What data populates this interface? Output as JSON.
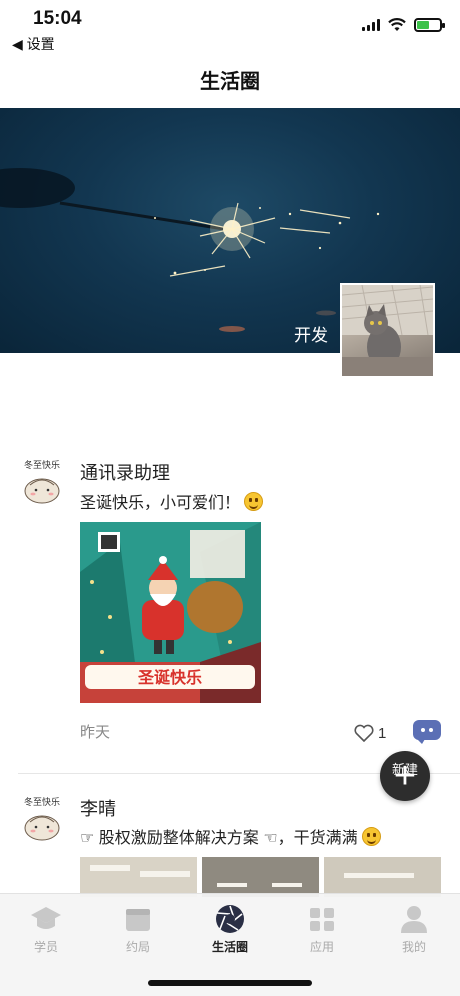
{
  "status_bar": {
    "time": "15:04",
    "back_label": "◀ 设置",
    "battery_color": "#3cc24a"
  },
  "nav": {
    "title": "生活圈"
  },
  "cover": {
    "username": "开发",
    "colors": {
      "sky_top": "#1e4a66",
      "sky_bottom": "#0a2539",
      "sparkle": "#fff2c8"
    }
  },
  "feed": [
    {
      "avatar_caption": "冬至快乐",
      "author": "通讯录助理",
      "text": "圣诞快乐，小可爱们！",
      "emoji": "smiley-icon",
      "image_caption": "圣诞快乐",
      "timestamp": "昨天",
      "likes": "1"
    },
    {
      "avatar_caption": "冬至快乐",
      "author": "李晴",
      "text": "☞ 股权激励整体解决方案 ☜，干货满满",
      "emoji": "smiley-icon"
    }
  ],
  "fab": {
    "label": "新建",
    "plus": "+"
  },
  "tabs": [
    {
      "label": "学员",
      "icon": "graduation-cap-icon",
      "active": false
    },
    {
      "label": "约局",
      "icon": "calendar-icon",
      "active": false
    },
    {
      "label": "生活圈",
      "icon": "aperture-icon",
      "active": true
    },
    {
      "label": "应用",
      "icon": "apps-icon",
      "active": false
    },
    {
      "label": "我的",
      "icon": "person-icon",
      "active": false
    }
  ],
  "colors": {
    "accent": "#2d2d2d",
    "comment": "#5b6fb5",
    "inactive_tab": "#aaaaaa"
  }
}
